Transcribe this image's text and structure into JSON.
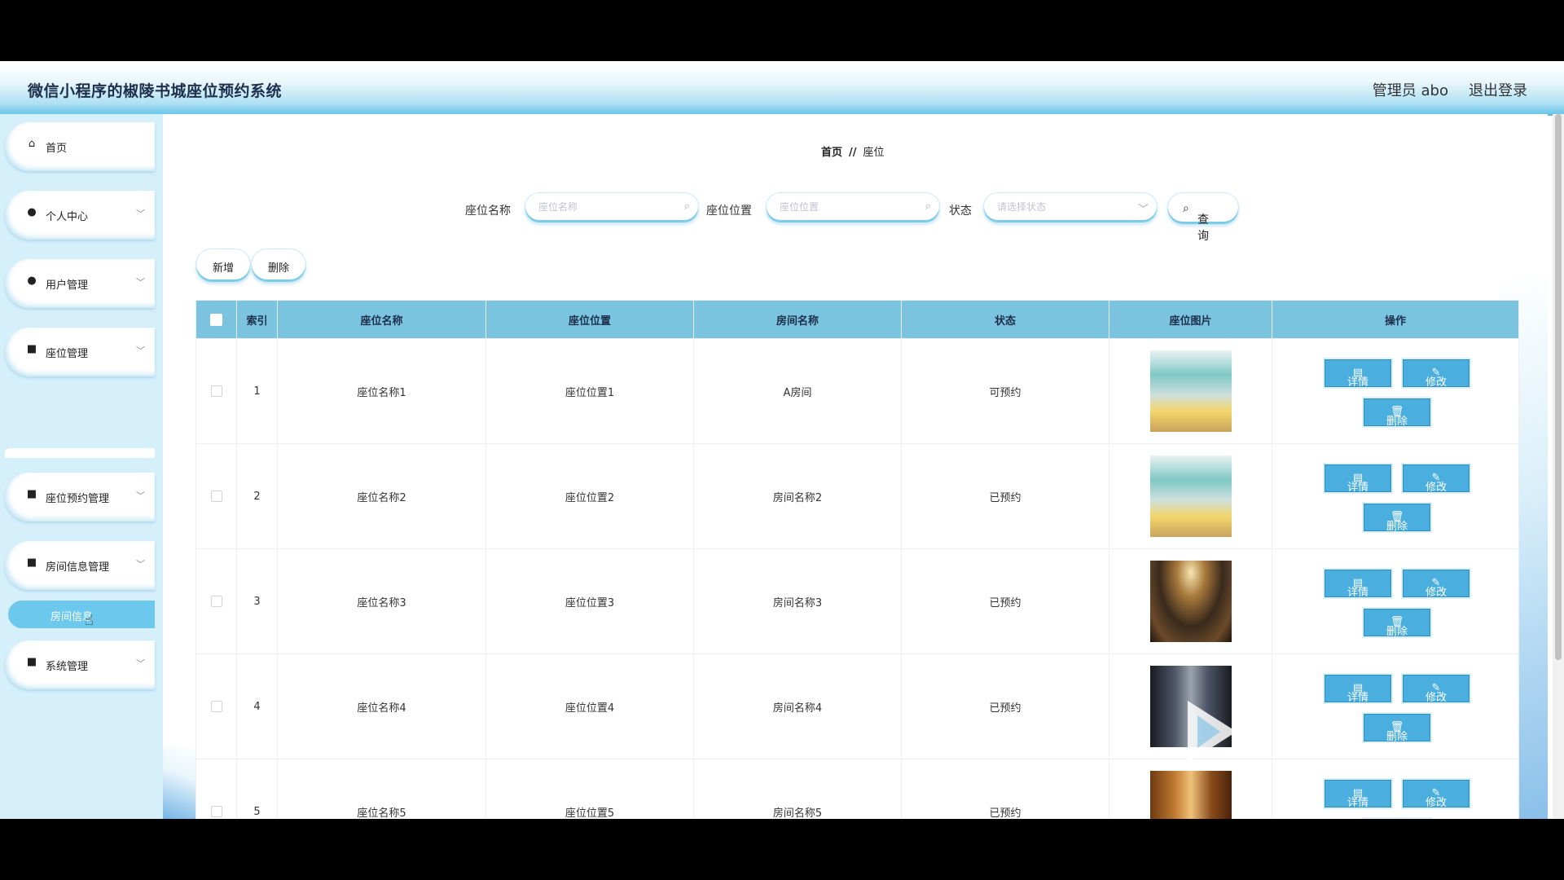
{
  "header": {
    "app_title": "微信小程序的椒陵书城座位预约系统",
    "admin_label": "管理员 abo",
    "logout": "退出登录"
  },
  "sidebar": {
    "items": [
      {
        "label": "首页",
        "icon": "home-icon"
      },
      {
        "label": "个人中心",
        "icon": "user-icon"
      },
      {
        "label": "用户管理",
        "icon": "pin-icon"
      },
      {
        "label": "座位管理",
        "icon": "grid-icon"
      },
      {
        "label": "座位预约管理",
        "icon": "grid-icon"
      },
      {
        "label": "房间信息管理",
        "icon": "grid-icon"
      },
      {
        "label": "系统管理",
        "icon": "grid-icon"
      }
    ],
    "active_sub": "房间信息"
  },
  "breadcrumb": {
    "home": "首页",
    "separator": "//",
    "current": "座位"
  },
  "search": {
    "seat_name_label": "座位名称",
    "seat_name_placeholder": "座位名称",
    "seat_location_label": "座位位置",
    "seat_location_placeholder": "座位位置",
    "status_label": "状态",
    "status_placeholder": "请选择状态",
    "query_button": "查询"
  },
  "actions": {
    "add": "新增",
    "delete": "删除"
  },
  "table": {
    "headers": [
      "索引",
      "座位名称",
      "座位位置",
      "房间名称",
      "状态",
      "座位图片",
      "操作"
    ],
    "rows": [
      {
        "index": "1",
        "seat_name": "座位名称1",
        "seat_location": "座位位置1",
        "room_name": "A房间",
        "status": "可预约"
      },
      {
        "index": "2",
        "seat_name": "座位名称2",
        "seat_location": "座位位置2",
        "room_name": "房间名称2",
        "status": "已预约"
      },
      {
        "index": "3",
        "seat_name": "座位名称3",
        "seat_location": "座位位置3",
        "room_name": "房间名称3",
        "status": "已预约"
      },
      {
        "index": "4",
        "seat_name": "座位名称4",
        "seat_location": "座位位置4",
        "room_name": "房间名称4",
        "status": "已预约"
      },
      {
        "index": "5",
        "seat_name": "座位名称5",
        "seat_location": "座位位置5",
        "room_name": "房间名称5",
        "status": "已预约"
      }
    ],
    "op_detail": "详情",
    "op_edit": "修改",
    "op_delete": "删除"
  },
  "colors": {
    "header_blue": "#7bc4e0",
    "button_blue": "#4aaede",
    "sidebar_bg": "#d6f0fb"
  }
}
